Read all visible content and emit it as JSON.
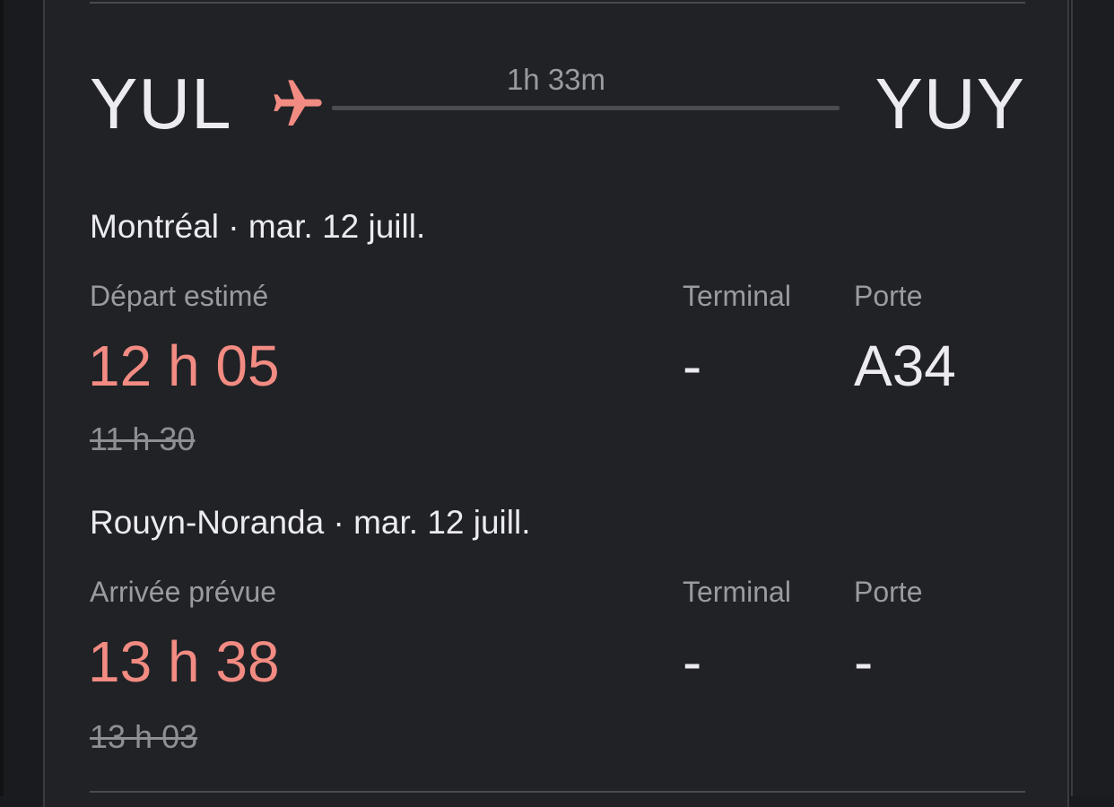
{
  "route": {
    "origin_code": "YUL",
    "destination_code": "YUY",
    "duration": "1h 33m",
    "plane_icon": "airplane-icon",
    "accent_color": "#f28b82"
  },
  "departure": {
    "title": "Montréal · mar. 12 juill.",
    "time_label": "Départ estimé",
    "time": "12 h 05",
    "scheduled_time": "11 h 30",
    "terminal_label": "Terminal",
    "terminal": "-",
    "gate_label": "Porte",
    "gate": "A34"
  },
  "arrival": {
    "title": "Rouyn-Noranda · mar. 12 juill.",
    "time_label": "Arrivée prévue",
    "time": "13 h 38",
    "scheduled_time": "13 h 03",
    "terminal_label": "Terminal",
    "terminal": "-",
    "gate_label": "Porte",
    "gate": "-"
  }
}
